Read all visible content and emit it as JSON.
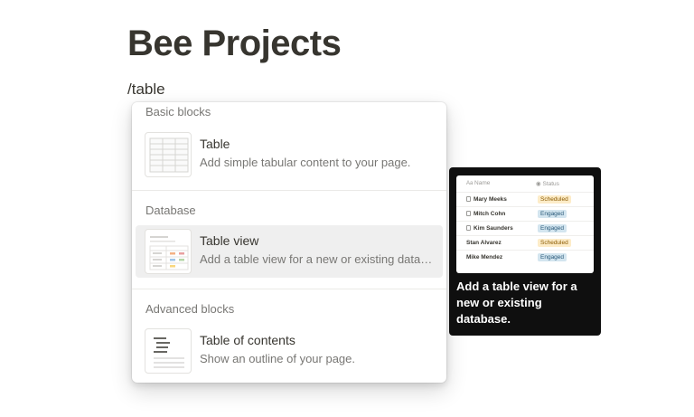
{
  "page": {
    "title": "Bee Projects",
    "typed_command": "/table"
  },
  "menu": {
    "sections": [
      {
        "header": "Basic blocks",
        "items": [
          {
            "title": "Table",
            "description": "Add simple tabular content to your page."
          }
        ]
      },
      {
        "header": "Database",
        "items": [
          {
            "title": "Table view",
            "description": "Add a table view for a new or existing database.",
            "selected": true
          }
        ]
      },
      {
        "header": "Advanced blocks",
        "items": [
          {
            "title": "Table of contents",
            "description": "Show an outline of your page."
          }
        ]
      }
    ]
  },
  "preview": {
    "columns": {
      "name": "Name",
      "status": "Status"
    },
    "rows": [
      {
        "name": "Mary Meeks",
        "status": "Scheduled"
      },
      {
        "name": "Mitch Cohn",
        "status": "Engaged"
      },
      {
        "name": "Kim Saunders",
        "status": "Engaged"
      },
      {
        "name": "Stan Alvarez",
        "status": "Scheduled"
      },
      {
        "name": "Mike Mendez",
        "status": "Engaged"
      }
    ],
    "description": "Add a table view for a new or existing database.",
    "status_colors": {
      "Scheduled": "#fdecc8",
      "Engaged": "#d3e5ef"
    }
  }
}
